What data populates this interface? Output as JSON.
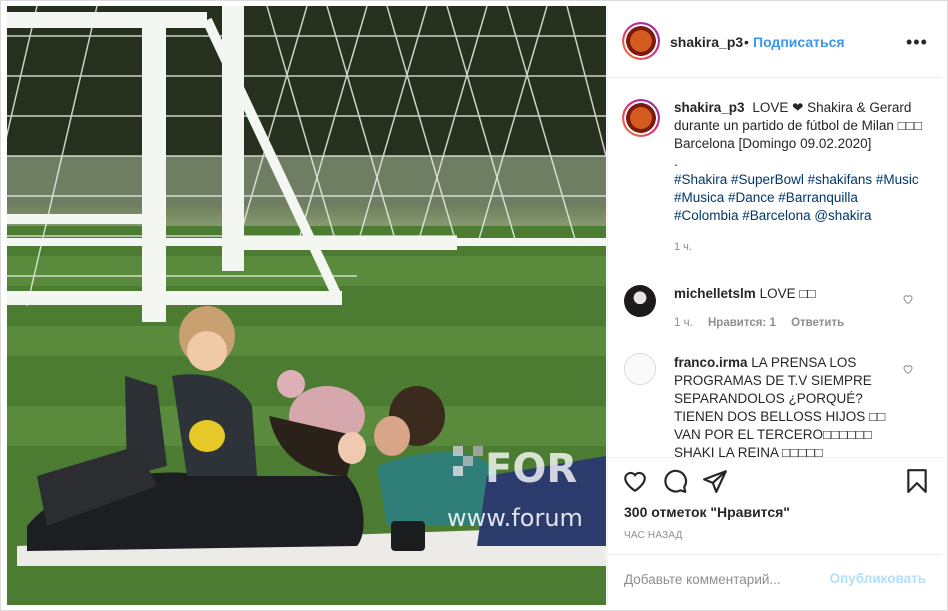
{
  "header": {
    "username": "shakira_p3",
    "separator": "•",
    "follow_label": "Подписаться",
    "more_label": "•••"
  },
  "caption": {
    "username": "shakira_p3",
    "text": "LOVE ❤ Shakira & Gerard durante un partido de fútbol de Milan □□□ Barcelona [Domingo 09.02.2020]",
    "dot": ".",
    "tags": "#Shakira #SuperBowl #shakifans #Music #Musica #Dance #Barranquilla #Colombia #Barcelona @shakira",
    "time": "1 ч."
  },
  "comments": [
    {
      "username": "michelletslm",
      "text": "LOVE □□",
      "time": "1 ч.",
      "likes_label": "Нравится: 1",
      "reply_label": "Ответить"
    },
    {
      "username": "franco.irma",
      "text": "LA PRENSA LOS PROGRAMAS DE T.V SIEMPRE SEPARANDOLOS ¿PORQUÉ? TIENEN DOS BELLOSS HIJOS □□ VAN POR EL TERCERO□□□□□□ SHAKI LA REINA □□□□□"
    }
  ],
  "stats": {
    "likes": "300 отметок \"Нравится\"",
    "posted": "ЧАС НАЗАД"
  },
  "composer": {
    "placeholder": "Добавьте комментарий...",
    "publish_label": "Опубликовать"
  },
  "photo": {
    "watermark": "FOR",
    "watermark_url": "www.forum"
  },
  "icons": [
    "more-icon",
    "heart-icon",
    "comment-icon",
    "share-icon",
    "bookmark-icon"
  ],
  "colors": {
    "link": "#3897f0",
    "tag": "#00376b",
    "muted": "#8e8e8e",
    "publish_disabled": "#b2dffc"
  }
}
